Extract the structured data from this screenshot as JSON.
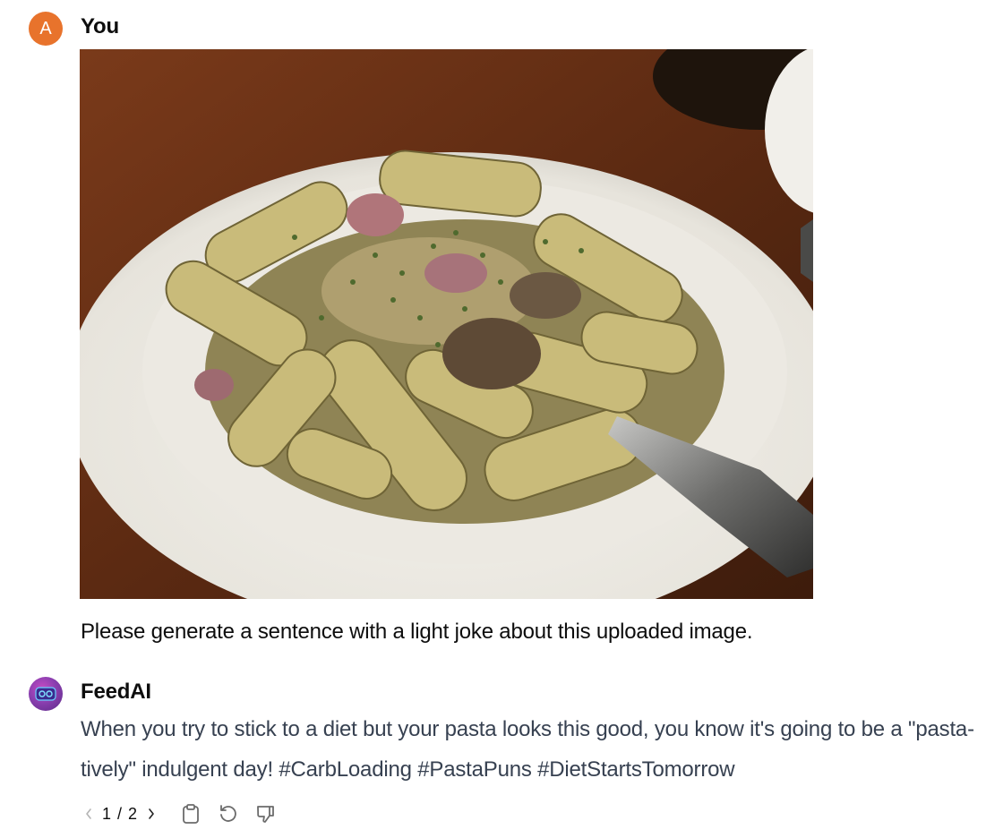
{
  "conversation": {
    "user": {
      "avatar_letter": "A",
      "name": "You",
      "message": "Please generate a sentence with a light joke about this uploaded image."
    },
    "assistant": {
      "name": "FeedAI",
      "message": "When you try to stick to a diet but your pasta looks this good, you know it's going to be a \"pasta-tively\" indulgent day! #CarbLoading #PastaPuns #DietStartsTomorrow"
    }
  },
  "response_actions": {
    "pager": "1 / 2",
    "icons": [
      "chevron-left-icon",
      "chevron-right-icon",
      "clipboard-icon",
      "regenerate-icon",
      "thumbs-down-icon"
    ]
  },
  "colors": {
    "user_avatar": "#e8732c",
    "assistant_avatar": "#8b3fb0",
    "reply_text": "#374151"
  }
}
